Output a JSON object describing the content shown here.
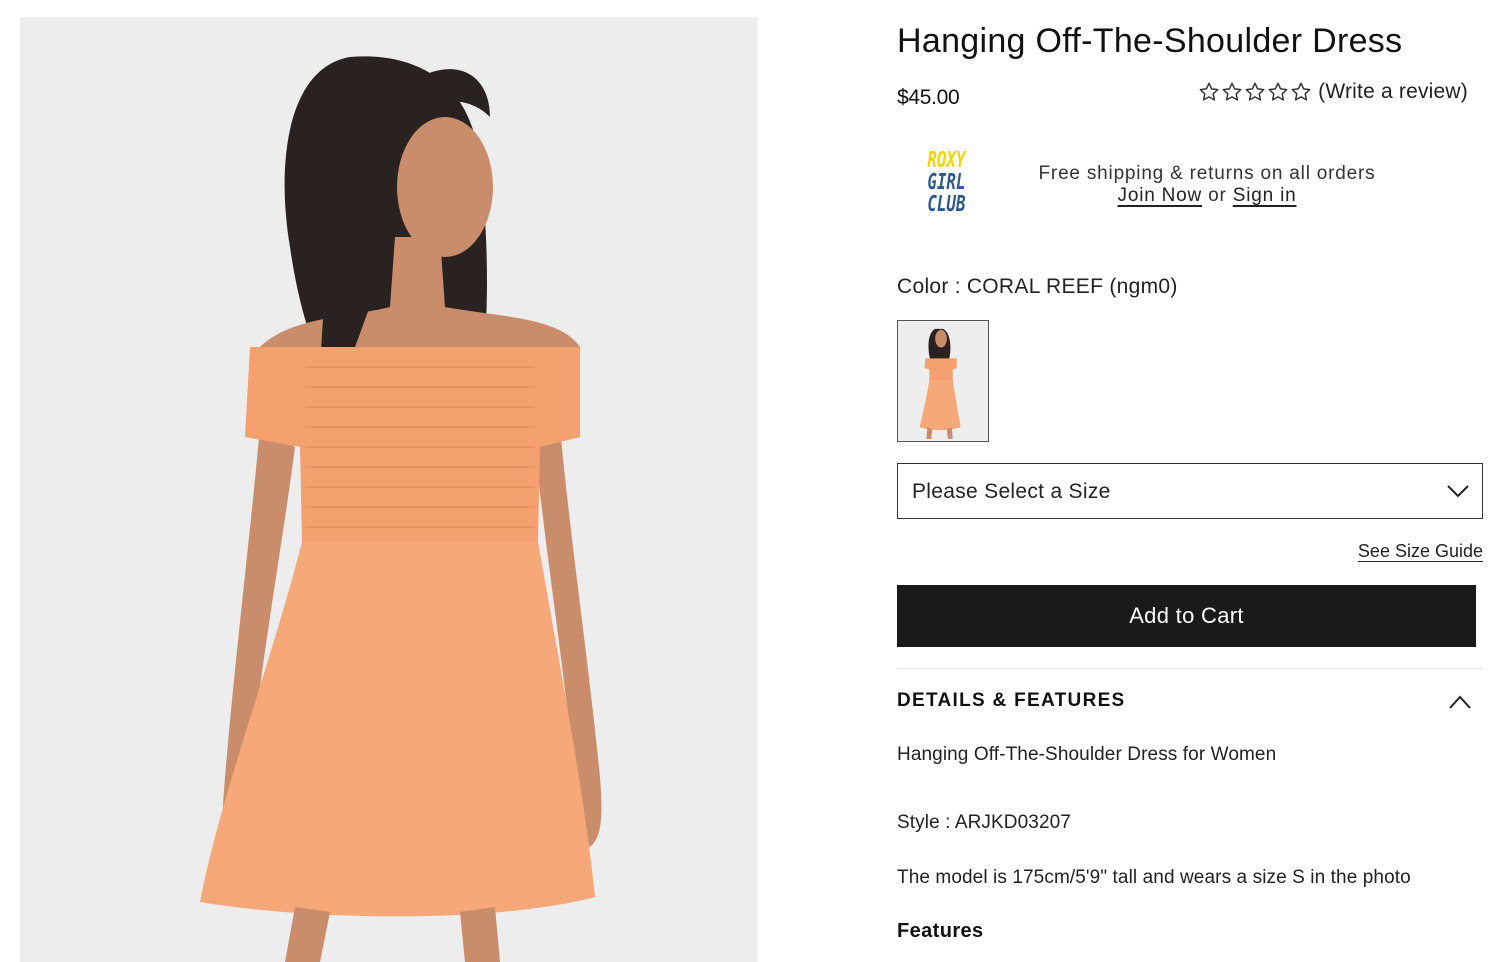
{
  "product": {
    "title": "Hanging Off-The-Shoulder Dress",
    "price": "$45.00",
    "rating_stars": 0,
    "review_link": "(Write a review)"
  },
  "club": {
    "logo_line1": "ROXY",
    "logo_line2": "GIRL",
    "logo_line3": "CLUB",
    "shipping_text": "Free shipping & returns on all orders",
    "join_now": "Join Now",
    "or": "or",
    "sign_in": "Sign in"
  },
  "color": {
    "label": "Color",
    "separator": ":",
    "value": "CORAL REEF (ngm0)"
  },
  "size": {
    "placeholder": "Please Select a Size",
    "guide_link": "See Size Guide"
  },
  "cart": {
    "button_label": "Add to Cart"
  },
  "details": {
    "title": "DETAILS & FEATURES",
    "description": "Hanging Off-The-Shoulder Dress for Women",
    "style": "Style : ARJKD03207",
    "model_info": "The model is 175cm/5'9\" tall and wears a size S in the photo",
    "features_heading": "Features"
  },
  "colors": {
    "dress": "#f7a878",
    "image_bg": "#ededed",
    "button_bg": "#1a1a1a",
    "logo_yellow": "#f4d400",
    "logo_blue": "#2d5a8c"
  }
}
